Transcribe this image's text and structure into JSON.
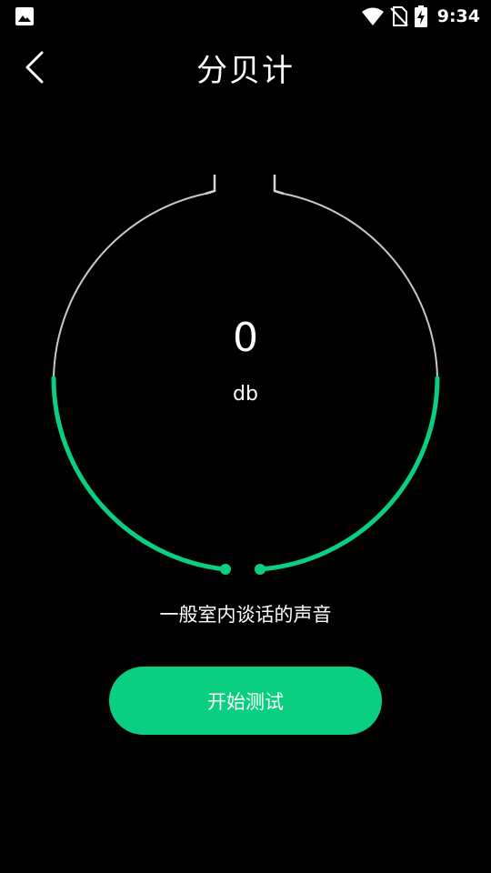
{
  "status_bar": {
    "time": "9:34",
    "icons": [
      "gallery-icon",
      "wifi-icon",
      "no-sim-icon",
      "battery-charging-icon"
    ]
  },
  "header": {
    "title": "分贝计",
    "back_icon": "chevron-left-icon"
  },
  "gauge": {
    "value": "0",
    "unit": "db",
    "level_fraction": 0.0,
    "track_color": "#bdbdbd",
    "active_color": "#0bcf80"
  },
  "description": "一般室内谈话的声音",
  "start_button": {
    "label": "开始测试",
    "color": "#0bcf80"
  }
}
